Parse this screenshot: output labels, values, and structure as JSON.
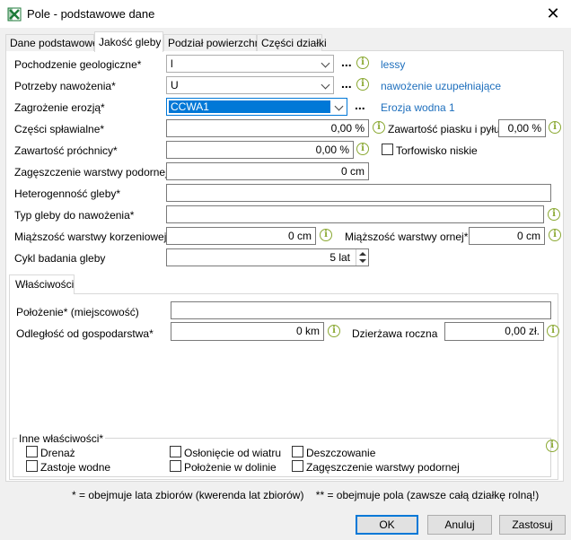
{
  "window": {
    "title": "Pole - podstawowe dane",
    "close": "✕"
  },
  "tabs": [
    "Dane podstawowe",
    "Jakość gleby",
    "Podział powierzchni",
    "Części działki"
  ],
  "form": {
    "pochodzenie": {
      "label": "Pochodzenie geologiczne*",
      "value": "l",
      "link": "lessy"
    },
    "potrzeby": {
      "label": "Potrzeby nawożenia*",
      "value": "U",
      "link": "nawożenie uzupełniające"
    },
    "zagrozenie": {
      "label": "Zagrożenie erozją*",
      "value": "CCWA1",
      "link": "Erozja wodna 1"
    },
    "czesci": {
      "label": "Części spławialne*",
      "value": "0,00 %"
    },
    "piasek": {
      "label": "Zawartość piasku i pyłu*",
      "value": "0,00 %"
    },
    "prochnica": {
      "label": "Zawartość próchnicy*",
      "value": "0,00 %"
    },
    "torfowisko": {
      "label": "Torfowisko niskie"
    },
    "zageszczenie": {
      "label": "Zagęszczenie warstwy podornej*",
      "value": "0 cm"
    },
    "heterogennosc": {
      "label": "Heterogenność gleby*",
      "value": ""
    },
    "typ": {
      "label": "Typ gleby do nawożenia*",
      "value": ""
    },
    "korzeniowa": {
      "label": "Miąższość warstwy korzeniowej*",
      "value": "0 cm"
    },
    "ornej": {
      "label": "Miąższość warstwy ornej*",
      "value": "0 cm"
    },
    "cykl": {
      "label": "Cykl badania gleby",
      "value": "5 lat"
    },
    "dots": "..."
  },
  "wlasciwosci": {
    "tab": "Właściwości",
    "polozenie": {
      "label": "Położenie* (miejscowość)",
      "value": ""
    },
    "odleglosc": {
      "label": "Odległość od gospodarstwa*",
      "value": "0 km"
    },
    "dzierzawa": {
      "label": "Dzierżawa roczna",
      "value": "0,00 zł."
    },
    "inne_title": "Inne właściwości*",
    "checks": [
      "Drenaż",
      "Zastoje wodne",
      "Osłonięcie od wiatru",
      "Położenie w dolinie",
      "Deszczowanie",
      "Zagęszczenie warstwy podornej"
    ]
  },
  "footnote": "* = obejmuje lata zbiorów (kwerenda lat zbiorów)    ** = obejmuje pola (zawsze całą działkę rolną!)",
  "buttons": {
    "ok": "OK",
    "cancel": "Anuluj",
    "apply": "Zastosuj"
  },
  "icons": {
    "app": "spreadsheet-icon",
    "info": "info-icon"
  },
  "colors": {
    "link": "#1e6fbd",
    "info": "#8aa832",
    "selection": "#0078d7"
  }
}
